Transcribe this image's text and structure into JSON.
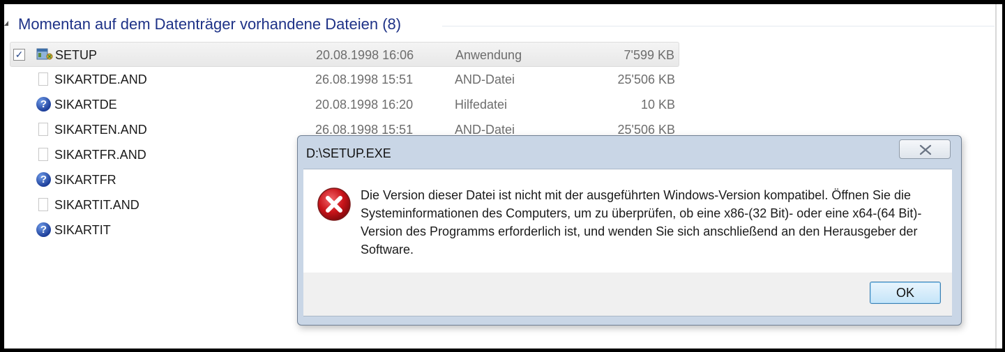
{
  "group": {
    "title": "Momentan auf dem Datenträger vorhandene Dateien (8)"
  },
  "files": [
    {
      "name": "SETUP",
      "date": "20.08.1998 16:06",
      "type": "Anwendung",
      "size": "7'599 KB",
      "icon": "application-icon",
      "selected": true,
      "checked": "✓"
    },
    {
      "name": "SIKARTDE.AND",
      "date": "26.08.1998 15:51",
      "type": "AND-Datei",
      "size": "25'506 KB",
      "icon": "document-icon"
    },
    {
      "name": "SIKARTDE",
      "date": "20.08.1998 16:20",
      "type": "Hilfedatei",
      "size": "10 KB",
      "icon": "help-file-icon"
    },
    {
      "name": "SIKARTEN.AND",
      "date": "26.08.1998 15:51",
      "type": "AND-Datei",
      "size": "25'506 KB",
      "icon": "document-icon"
    },
    {
      "name": "SIKARTFR.AND",
      "date": "",
      "type": "",
      "size": "",
      "icon": "document-icon"
    },
    {
      "name": "SIKARTFR",
      "date": "",
      "type": "",
      "size": "",
      "icon": "help-file-icon"
    },
    {
      "name": "SIKARTIT.AND",
      "date": "",
      "type": "",
      "size": "",
      "icon": "document-icon"
    },
    {
      "name": "SIKARTIT",
      "date": "",
      "type": "",
      "size": "",
      "icon": "help-file-icon"
    }
  ],
  "dialog": {
    "title": "D:\\SETUP.EXE",
    "close_icon": "close-icon",
    "error_icon": "error-icon",
    "message": "Die Version dieser Datei ist nicht mit der ausgeführten Windows-Version kompatibel. Öffnen Sie die Systeminformationen des Computers, um zu überprüfen, ob eine x86-(32 Bit)- oder eine x64-(64 Bit)-Version des Programms erforderlich ist, und wenden Sie sich anschließend an den Herausgeber der Software.",
    "ok_label": "OK"
  },
  "colors": {
    "group_title": "#1e3287",
    "dialog_frame": "#c9d6e6",
    "error_red": "#c9141a",
    "help_blue": "#1d3f9a"
  }
}
